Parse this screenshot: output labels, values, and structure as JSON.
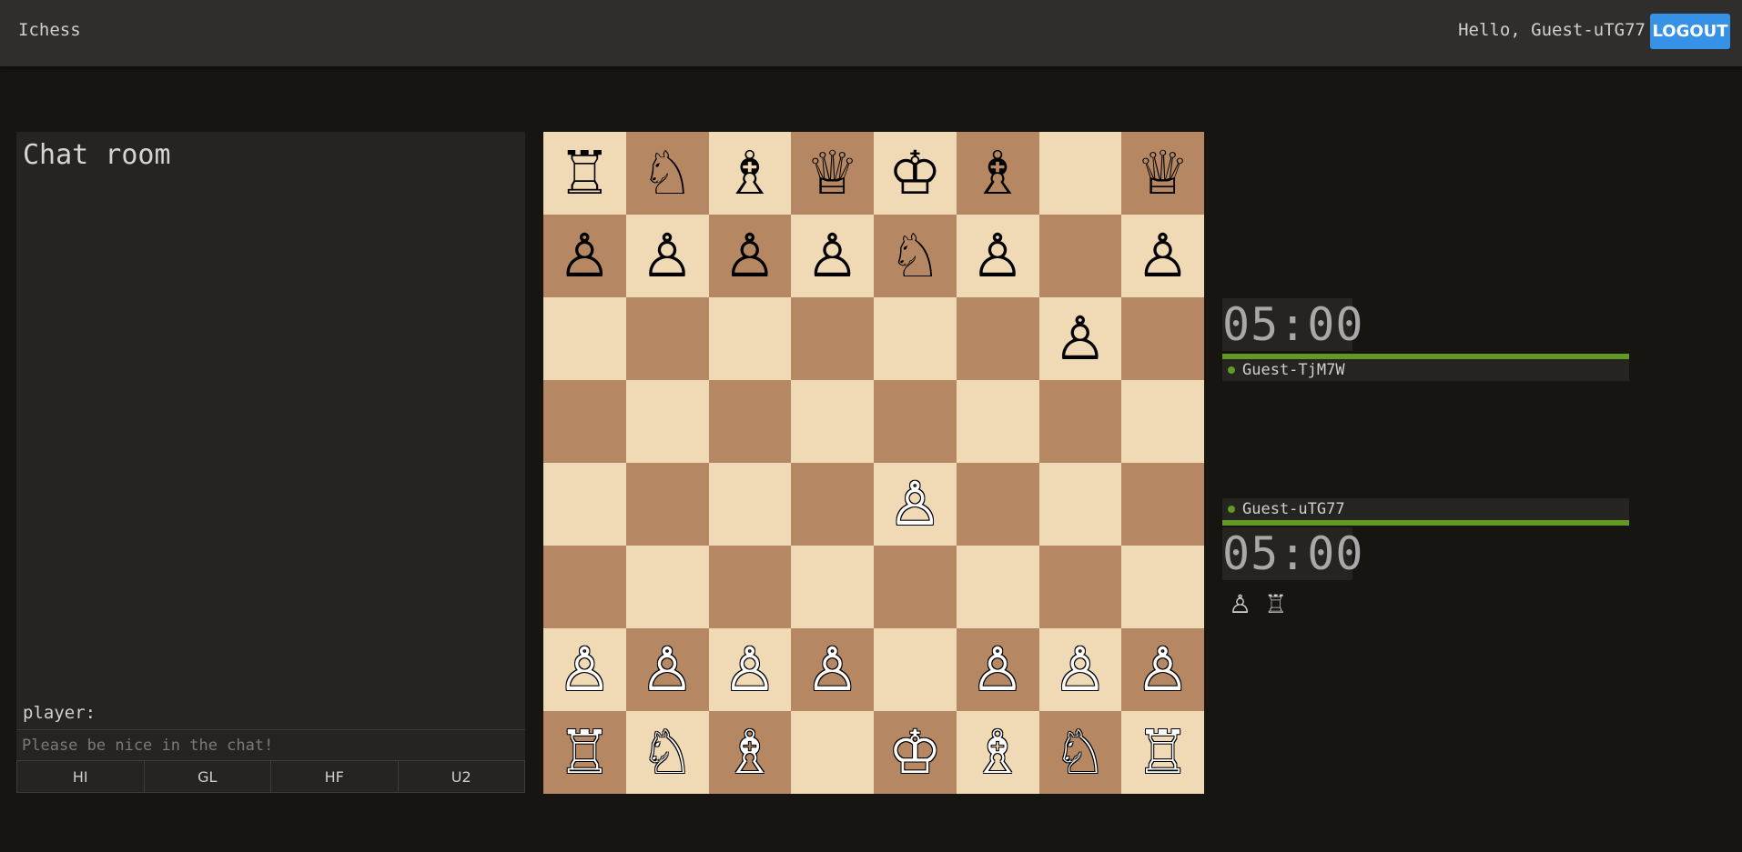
{
  "header": {
    "brand": "Ichess",
    "greeting": "Hello, Guest-uTG77",
    "logout_label": "LOGOUT"
  },
  "chat": {
    "title": "Chat room",
    "player_label": "player:",
    "input_placeholder": "Please be nice in the chat!",
    "quick_buttons": [
      "HI",
      "GL",
      "HF",
      "U2"
    ]
  },
  "board": {
    "ranks": [
      [
        "r",
        "n",
        "b",
        "q",
        "k",
        "b",
        "",
        "q"
      ],
      [
        "p",
        "p",
        "p",
        "p",
        "n",
        "p",
        "",
        "p"
      ],
      [
        "",
        "",
        "",
        "",
        "",
        "",
        "p",
        ""
      ],
      [
        "",
        "",
        "",
        "",
        "",
        "",
        "",
        ""
      ],
      [
        "",
        "",
        "",
        "",
        "P",
        "",
        "",
        ""
      ],
      [
        "",
        "",
        "",
        "",
        "",
        "",
        "",
        ""
      ],
      [
        "P",
        "P",
        "P",
        "P",
        "",
        "P",
        "P",
        "P"
      ],
      [
        "R",
        "N",
        "B",
        "",
        "K",
        "B",
        "N",
        "R"
      ]
    ]
  },
  "opponent": {
    "name": "Guest-TjM7W",
    "clock": "05:00"
  },
  "player": {
    "name": "Guest-uTG77",
    "clock": "05:00",
    "captured": [
      "pawn",
      "rook"
    ]
  }
}
